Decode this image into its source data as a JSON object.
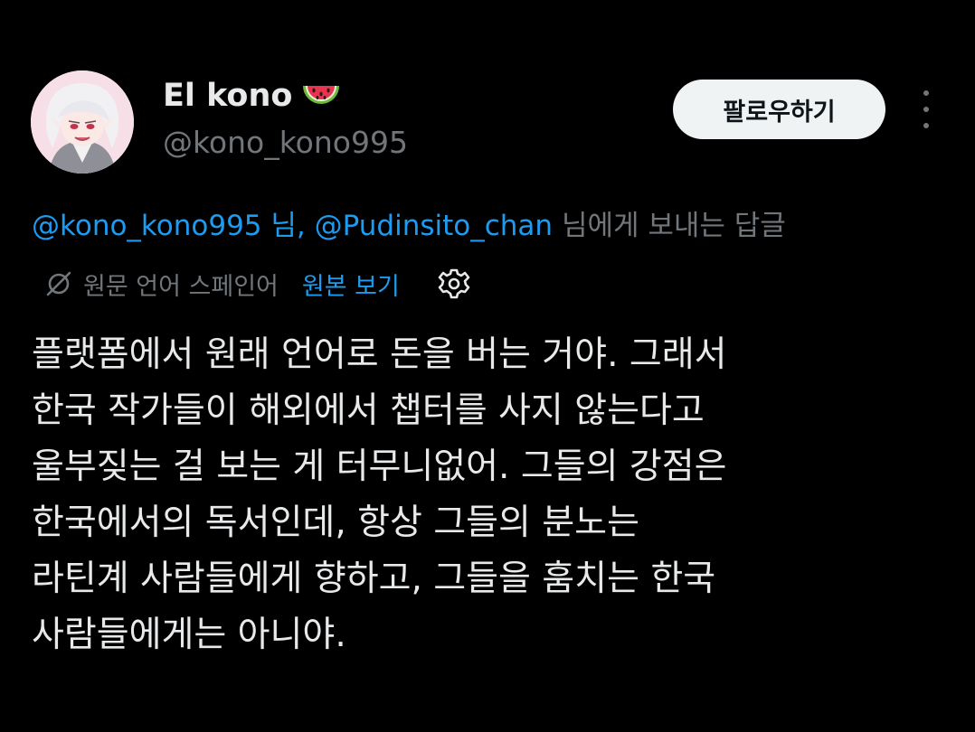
{
  "author": {
    "display_name": "El kono",
    "name_emoji": "watermelon-icon",
    "handle": "@kono_kono995"
  },
  "follow_label": "팔로우하기",
  "reply_context": {
    "mention1": "@kono_kono995",
    "sep1": " 님, ",
    "mention2": "@Pudinsito_chan",
    "suffix": " 님에게 보내는 답글"
  },
  "translation": {
    "source_lang": "원문 언어 스페인어",
    "view_original": "원본 보기"
  },
  "tweet_lines": [
    "플랫폼에서 원래 언어로 돈을 버는 거야. 그래서",
    "한국 작가들이 해외에서 챕터를 사지 않는다고",
    "울부짖는 걸 보는 게 터무니없어. 그들의 강점은",
    "한국에서의 독서인데, 항상 그들의 분노는",
    "라틴계 사람들에게 향하고, 그들을 훔치는 한국",
    "사람들에게는 아니야."
  ],
  "colors": {
    "background": "#000000",
    "text": "#e7e9ea",
    "secondary": "#71767b",
    "link": "#1d9bf0",
    "button_bg": "#eff3f4"
  }
}
